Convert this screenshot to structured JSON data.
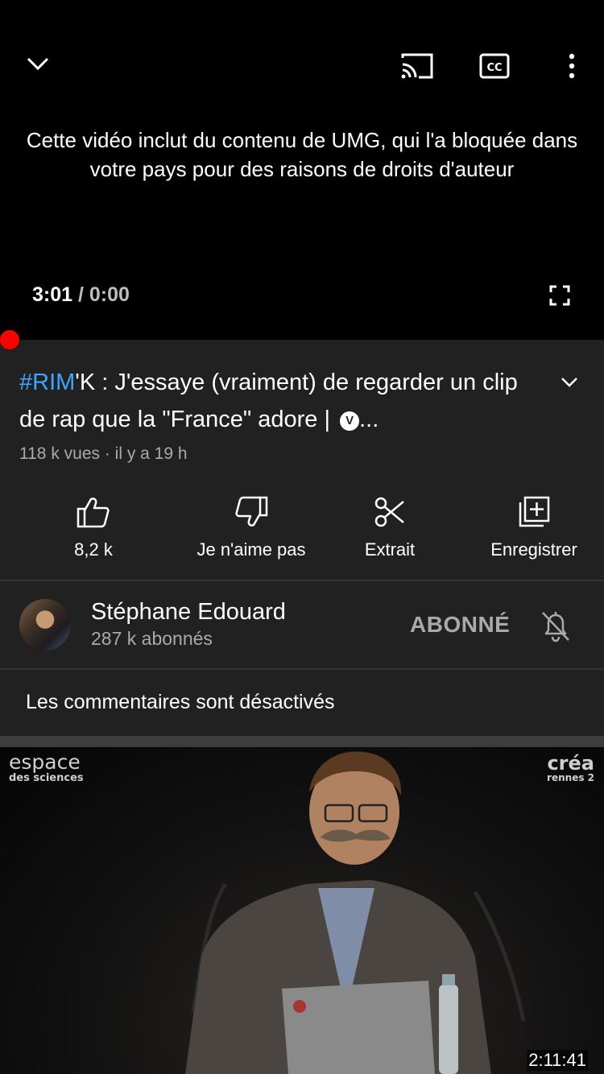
{
  "player": {
    "blocked_message": "Cette vidéo inclut du contenu de UMG, qui l'a bloquée dans votre pays pour des raisons de droits d'auteur",
    "current_time": "3:01",
    "separator": " / ",
    "duration": "0:00",
    "icons": [
      "chevron-down-icon",
      "cast-icon",
      "captions-icon",
      "more-vert-icon",
      "fullscreen-icon"
    ],
    "progress_color": "#ff0000"
  },
  "video": {
    "title_tag": "#RIM",
    "title_text": "'K : J'essaye (vraiment) de regarder un clip de rap que la \"France\" adore | ",
    "verified_badge": "V",
    "title_ellipsis": "...",
    "meta": "118 k vues · il y a 19 h",
    "tag_color": "#3ea6ff"
  },
  "actions": [
    {
      "icon": "thumbs-up-icon",
      "label": "8,2 k"
    },
    {
      "icon": "thumbs-down-icon",
      "label": "Je n'aime pas"
    },
    {
      "icon": "scissors-icon",
      "label": "Extrait"
    },
    {
      "icon": "playlist-add-icon",
      "label": "Enregistrer"
    }
  ],
  "channel": {
    "name": "Stéphane Edouard",
    "subscribers": "287 k abonnés",
    "subscribe_label": "ABONNÉ",
    "bell_icon": "bell-off-icon"
  },
  "comments": {
    "status": "Les commentaires sont désactivés"
  },
  "next_video": {
    "watermark_left_big": "espace",
    "watermark_left_small": "des sciences",
    "watermark_right_big": "créa",
    "watermark_right_small": "rennes 2",
    "duration": "2:11:41"
  }
}
